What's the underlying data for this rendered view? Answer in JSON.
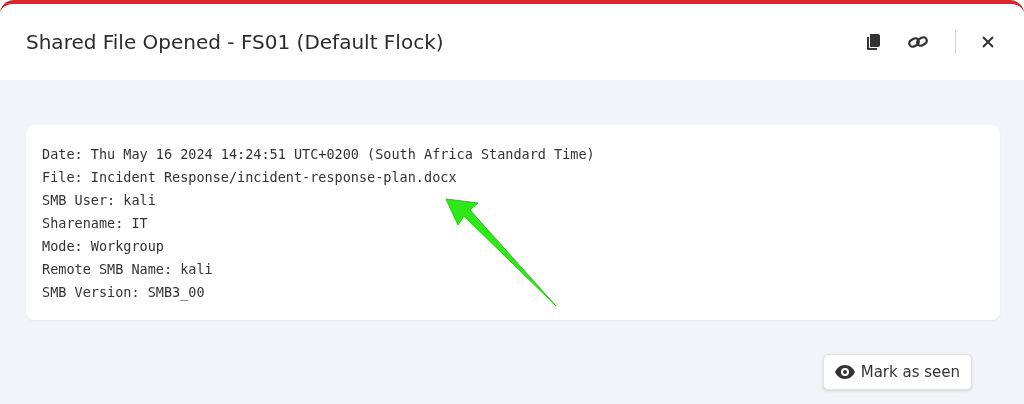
{
  "dialog": {
    "title": "Shared File Opened - FS01 (Default Flock)"
  },
  "details": [
    "Date: Thu May 16 2024 14:24:51 UTC+0200 (South Africa Standard Time)",
    "File: Incident Response/incident-response-plan.docx",
    "SMB User: kali",
    "Sharename: IT",
    "Mode: Workgroup",
    "Remote SMB Name: kali",
    "SMB Version: SMB3_00"
  ],
  "action_button": {
    "label": "Mark as seen"
  }
}
